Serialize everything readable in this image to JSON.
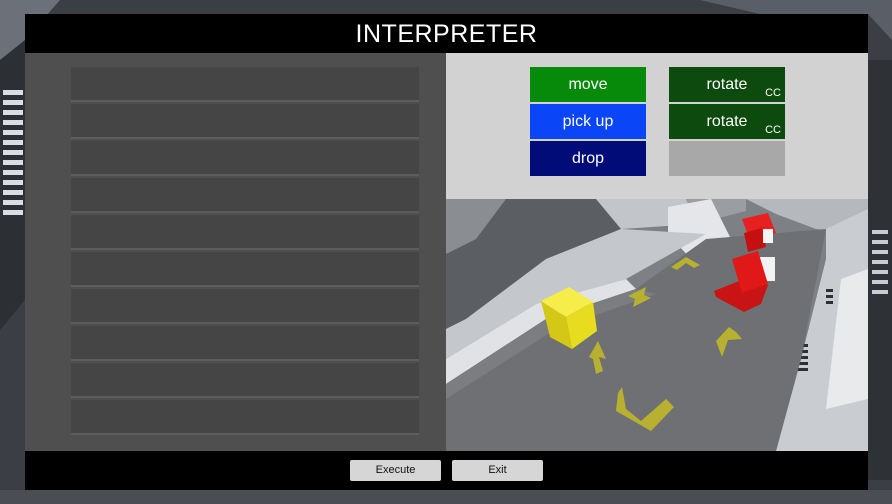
{
  "window": {
    "title": "INTERPRETER"
  },
  "program": {
    "slot_count": 10
  },
  "palette": {
    "commands": [
      {
        "label": "move",
        "sub": "",
        "color": "#078a0a"
      },
      {
        "label": "pick up",
        "sub": "",
        "color": "#0a45f8"
      },
      {
        "label": "drop",
        "sub": "",
        "color": "#020c78"
      },
      {
        "label": "rotate",
        "sub": "CC",
        "color": "#0d4a0d"
      },
      {
        "label": "rotate",
        "sub": "CC",
        "color": "#0d4a0d"
      }
    ],
    "empty_slot_color": "#a8a8a8"
  },
  "footer": {
    "execute_label": "Execute",
    "exit_label": "Exit"
  },
  "colors": {
    "panel_bg": "#000000",
    "program_bg": "#4f4f4f",
    "palette_bg": "#d2d2d2",
    "cube": "#f2e61a",
    "robot": "#e01818",
    "arrows": "#b8b030"
  }
}
